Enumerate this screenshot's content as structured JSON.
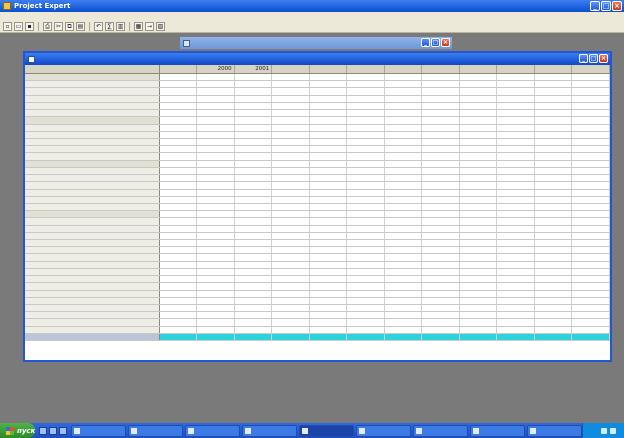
{
  "app": {
    "title": "Project Expert",
    "menu": [
      "",
      "",
      "",
      "",
      "",
      ""
    ]
  },
  "toolbar": {
    "icons": [
      "new-icon",
      "open-icon",
      "save-icon",
      "print-icon",
      "cut-icon",
      "copy-icon",
      "paste-icon",
      "undo-icon",
      "calc-icon",
      "chart-icon",
      "table-icon",
      "arrow-icon",
      "report-icon"
    ]
  },
  "background_window": {
    "title": ""
  },
  "cashflow_window": {
    "title": "",
    "columns": [
      "",
      "2000",
      "2001",
      "",
      "",
      "",
      "",
      "",
      "",
      "",
      "",
      ""
    ],
    "rows": [
      {
        "label": "",
        "group": true,
        "values": [
          "",
          "",
          "",
          "",
          "",
          "",
          "",
          "",
          "",
          "",
          "",
          ""
        ]
      },
      {
        "label": "",
        "group": false,
        "values": [
          "",
          "",
          "",
          "",
          "",
          "",
          "",
          "",
          "",
          "",
          "",
          ""
        ]
      },
      {
        "label": "",
        "group": false,
        "values": [
          "",
          "",
          "",
          "",
          "",
          "",
          "",
          "",
          "",
          "",
          "",
          ""
        ]
      },
      {
        "label": "",
        "group": false,
        "values": [
          "",
          "",
          "",
          "",
          "",
          "",
          "",
          "",
          "",
          "",
          "",
          ""
        ]
      },
      {
        "label": "",
        "group": false,
        "values": [
          "",
          "",
          "",
          "",
          "",
          "",
          "",
          "",
          "",
          "",
          "",
          ""
        ]
      },
      {
        "label": "",
        "group": false,
        "values": [
          "",
          "",
          "",
          "",
          "",
          "",
          "",
          "",
          "",
          "",
          "",
          ""
        ]
      },
      {
        "label": "",
        "group": true,
        "values": [
          "",
          "",
          "",
          "",
          "",
          "",
          "",
          "",
          "",
          "",
          "",
          ""
        ]
      },
      {
        "label": "",
        "group": false,
        "values": [
          "",
          "",
          "",
          "",
          "",
          "",
          "",
          "",
          "",
          "",
          "",
          ""
        ]
      },
      {
        "label": "",
        "group": false,
        "values": [
          "",
          "",
          "",
          "",
          "",
          "",
          "",
          "",
          "",
          "",
          "",
          ""
        ]
      },
      {
        "label": "",
        "group": false,
        "values": [
          "",
          "",
          "",
          "",
          "",
          "",
          "",
          "",
          "",
          "",
          "",
          ""
        ]
      },
      {
        "label": "",
        "group": false,
        "values": [
          "",
          "",
          "",
          "",
          "",
          "",
          "",
          "",
          "",
          "",
          "",
          ""
        ]
      },
      {
        "label": "",
        "group": false,
        "values": [
          "",
          "",
          "",
          "",
          "",
          "",
          "",
          "",
          "",
          "",
          "",
          ""
        ]
      },
      {
        "label": "",
        "group": true,
        "values": [
          "",
          "",
          "",
          "",
          "",
          "",
          "",
          "",
          "",
          "",
          "",
          ""
        ]
      },
      {
        "label": "",
        "group": false,
        "values": [
          "",
          "",
          "",
          "",
          "",
          "",
          "",
          "",
          "",
          "",
          "",
          ""
        ]
      },
      {
        "label": "",
        "group": false,
        "values": [
          "",
          "",
          "",
          "",
          "",
          "",
          "",
          "",
          "",
          "",
          "",
          ""
        ]
      },
      {
        "label": "",
        "group": false,
        "values": [
          "",
          "",
          "",
          "",
          "",
          "",
          "",
          "",
          "",
          "",
          "",
          ""
        ]
      },
      {
        "label": "",
        "group": false,
        "values": [
          "",
          "",
          "",
          "",
          "",
          "",
          "",
          "",
          "",
          "",
          "",
          ""
        ]
      },
      {
        "label": "",
        "group": false,
        "values": [
          "",
          "",
          "",
          "",
          "",
          "",
          "",
          "",
          "",
          "",
          "",
          ""
        ]
      },
      {
        "label": "",
        "group": false,
        "values": [
          "",
          "",
          "",
          "",
          "",
          "",
          "",
          "",
          "",
          "",
          "",
          ""
        ]
      },
      {
        "label": "",
        "group": true,
        "values": [
          "",
          "",
          "",
          "",
          "",
          "",
          "",
          "",
          "",
          "",
          "",
          ""
        ]
      },
      {
        "label": "",
        "group": false,
        "values": [
          "",
          "",
          "",
          "",
          "",
          "",
          "",
          "",
          "",
          "",
          "",
          ""
        ]
      },
      {
        "label": "",
        "group": false,
        "values": [
          "",
          "",
          "",
          "",
          "",
          "",
          "",
          "",
          "",
          "",
          "",
          ""
        ]
      },
      {
        "label": "",
        "group": false,
        "values": [
          "",
          "",
          "",
          "",
          "",
          "",
          "",
          "",
          "",
          "",
          "",
          ""
        ]
      },
      {
        "label": "",
        "group": false,
        "values": [
          "",
          "",
          "",
          "",
          "",
          "",
          "",
          "",
          "",
          "",
          "",
          ""
        ]
      },
      {
        "label": "",
        "group": false,
        "values": [
          "",
          "",
          "",
          "",
          "",
          "",
          "",
          "",
          "",
          "",
          "",
          ""
        ]
      },
      {
        "label": "",
        "group": false,
        "values": [
          "",
          "",
          "",
          "",
          "",
          "",
          "",
          "",
          "",
          "",
          "",
          ""
        ]
      },
      {
        "label": "",
        "group": false,
        "values": [
          "",
          "",
          "",
          "",
          "",
          "",
          "",
          "",
          "",
          "",
          "",
          ""
        ]
      },
      {
        "label": "",
        "group": false,
        "values": [
          "",
          "",
          "",
          "",
          "",
          "",
          "",
          "",
          "",
          "",
          "",
          ""
        ]
      },
      {
        "label": "",
        "group": false,
        "values": [
          "",
          "",
          "",
          "",
          "",
          "",
          "",
          "",
          "",
          "",
          "",
          ""
        ]
      },
      {
        "label": "",
        "group": false,
        "values": [
          "",
          "",
          "",
          "",
          "",
          "",
          "",
          "",
          "",
          "",
          "",
          ""
        ]
      },
      {
        "label": "",
        "group": false,
        "values": [
          "",
          "",
          "",
          "",
          "",
          "",
          "",
          "",
          "",
          "",
          "",
          ""
        ]
      },
      {
        "label": "",
        "group": false,
        "values": [
          "",
          "",
          "",
          "",
          "",
          "",
          "",
          "",
          "",
          "",
          "",
          ""
        ]
      },
      {
        "label": "",
        "group": false,
        "values": [
          "",
          "",
          "",
          "",
          "",
          "",
          "",
          "",
          "",
          "",
          "",
          ""
        ]
      },
      {
        "label": "",
        "group": false,
        "values": [
          "",
          "",
          "",
          "",
          "",
          "",
          "",
          "",
          "",
          "",
          "",
          ""
        ]
      },
      {
        "label": "",
        "group": false,
        "values": [
          "",
          "",
          "",
          "",
          "",
          "",
          "",
          "",
          "",
          "",
          "",
          ""
        ]
      },
      {
        "label": "",
        "group": false,
        "values": [
          "",
          "",
          "",
          "",
          "",
          "",
          "",
          "",
          "",
          "",
          "",
          ""
        ]
      },
      {
        "label": "",
        "group": false,
        "last": true,
        "values": [
          "",
          "",
          "",
          "",
          "",
          "",
          "",
          "",
          "",
          "",
          "",
          ""
        ]
      }
    ]
  },
  "taskbar": {
    "start_label": "пуск",
    "tasks": [
      "",
      "",
      "",
      "",
      "",
      "",
      "",
      "",
      ""
    ],
    "clock": ""
  },
  "colors": {
    "titlebar": "#0a4fd0",
    "highlight_row": "#2bd3dd",
    "taskbar": "#1f4fbf"
  }
}
